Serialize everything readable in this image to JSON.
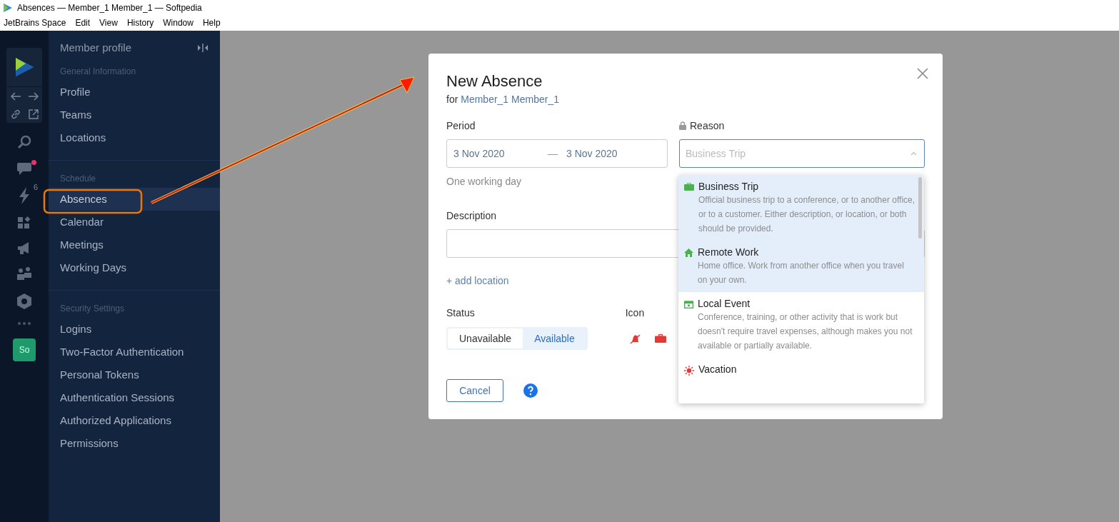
{
  "window": {
    "title": "Absences — Member_1 Member_1 — Softpedia"
  },
  "menu_bar": [
    "JetBrains Space",
    "Edit",
    "View",
    "History",
    "Window",
    "Help"
  ],
  "rail": {
    "notification_count": "6",
    "chat_unread": true,
    "avatar": "So"
  },
  "sidebar": {
    "title": "Member profile",
    "sections": [
      {
        "label": "General Information",
        "items": [
          {
            "label": "Profile",
            "selected": false
          },
          {
            "label": "Teams",
            "selected": false
          },
          {
            "label": "Locations",
            "selected": false
          }
        ]
      },
      {
        "label": "Schedule",
        "items": [
          {
            "label": "Absences",
            "selected": true
          },
          {
            "label": "Calendar",
            "selected": false
          },
          {
            "label": "Meetings",
            "selected": false
          },
          {
            "label": "Working Days",
            "selected": false
          }
        ]
      },
      {
        "label": "Security Settings",
        "items": [
          {
            "label": "Logins",
            "selected": false
          },
          {
            "label": "Two-Factor Authentication",
            "selected": false
          },
          {
            "label": "Personal Tokens",
            "selected": false
          },
          {
            "label": "Authentication Sessions",
            "selected": false
          },
          {
            "label": "Authorized Applications",
            "selected": false
          },
          {
            "label": "Permissions",
            "selected": false
          }
        ]
      }
    ]
  },
  "dialog": {
    "title": "New Absence",
    "for_prefix": "for",
    "member": "Member_1 Member_1",
    "period": {
      "label": "Period",
      "from": "3 Nov 2020",
      "separator": "—",
      "to": "3 Nov 2020",
      "hint": "One working day"
    },
    "reason": {
      "label": "Reason",
      "placeholder": "Business Trip",
      "expanded": true,
      "options": [
        {
          "kind": "briefcase",
          "color": "#4caf50",
          "title": "Business Trip",
          "description": "Official business trip to a conference, or to another office, or to a customer. Either description, or location, or both should be provided.",
          "highlighted": true
        },
        {
          "kind": "home",
          "color": "#4caf50",
          "title": "Remote Work",
          "description": "Home office. Work from another office when you travel on your own.",
          "highlighted": true
        },
        {
          "kind": "event",
          "color": "#4caf50",
          "title": "Local Event",
          "description": "Conference, training, or other activity that is work but doesn't require travel expenses, although makes you not available or partially available.",
          "highlighted": false
        },
        {
          "kind": "sun",
          "color": "#e53935",
          "title": "Vacation",
          "highlighted": false
        }
      ]
    },
    "description": {
      "label": "Description"
    },
    "add_location": "+ add location",
    "status": {
      "label": "Status",
      "options": [
        {
          "label": "Unavailable",
          "selected": false
        },
        {
          "label": "Available",
          "selected": true
        }
      ]
    },
    "icon": {
      "label": "Icon"
    },
    "cancel": "Cancel"
  }
}
